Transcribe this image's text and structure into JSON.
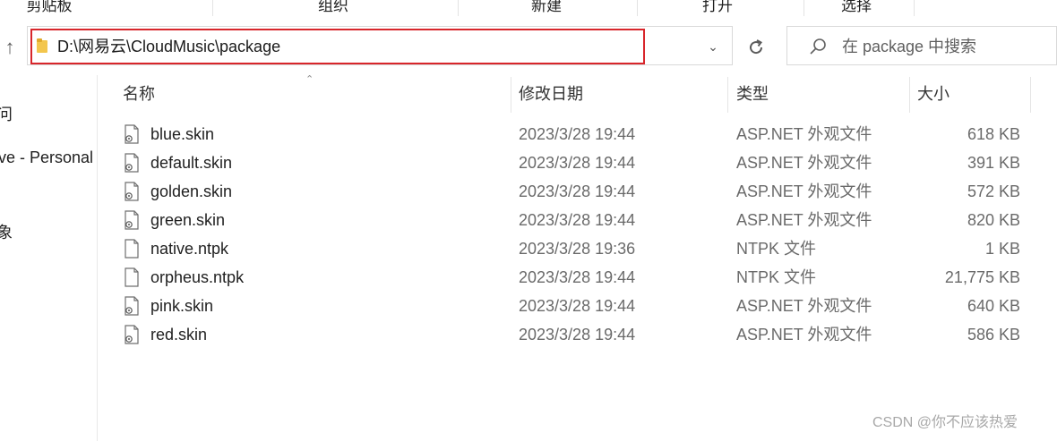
{
  "ribbon": {
    "groups": [
      "剪贴板",
      "组织",
      "新建",
      "打开",
      "选择"
    ]
  },
  "address": {
    "path": "D:\\网易云\\CloudMusic\\package"
  },
  "search": {
    "placeholder": "在 package 中搜索"
  },
  "nav": {
    "items": [
      "问",
      "ive - Personal",
      "象"
    ]
  },
  "columns": {
    "name": "名称",
    "date": "修改日期",
    "type": "类型",
    "size": "大小"
  },
  "files": [
    {
      "name": "blue.skin",
      "date": "2023/3/28 19:44",
      "type": "ASP.NET 外观文件",
      "size": "618 KB",
      "icon": "skin-file-icon"
    },
    {
      "name": "default.skin",
      "date": "2023/3/28 19:44",
      "type": "ASP.NET 外观文件",
      "size": "391 KB",
      "icon": "skin-file-icon"
    },
    {
      "name": "golden.skin",
      "date": "2023/3/28 19:44",
      "type": "ASP.NET 外观文件",
      "size": "572 KB",
      "icon": "skin-file-icon"
    },
    {
      "name": "green.skin",
      "date": "2023/3/28 19:44",
      "type": "ASP.NET 外观文件",
      "size": "820 KB",
      "icon": "skin-file-icon"
    },
    {
      "name": "native.ntpk",
      "date": "2023/3/28 19:36",
      "type": "NTPK 文件",
      "size": "1 KB",
      "icon": "blank-file-icon"
    },
    {
      "name": "orpheus.ntpk",
      "date": "2023/3/28 19:44",
      "type": "NTPK 文件",
      "size": "21,775 KB",
      "icon": "blank-file-icon"
    },
    {
      "name": "pink.skin",
      "date": "2023/3/28 19:44",
      "type": "ASP.NET 外观文件",
      "size": "640 KB",
      "icon": "skin-file-icon"
    },
    {
      "name": "red.skin",
      "date": "2023/3/28 19:44",
      "type": "ASP.NET 外观文件",
      "size": "586 KB",
      "icon": "skin-file-icon"
    }
  ],
  "watermark": "CSDN @你不应该热爱",
  "colors": {
    "highlight_border": "#d8262b",
    "folder": "#f3c64d"
  }
}
